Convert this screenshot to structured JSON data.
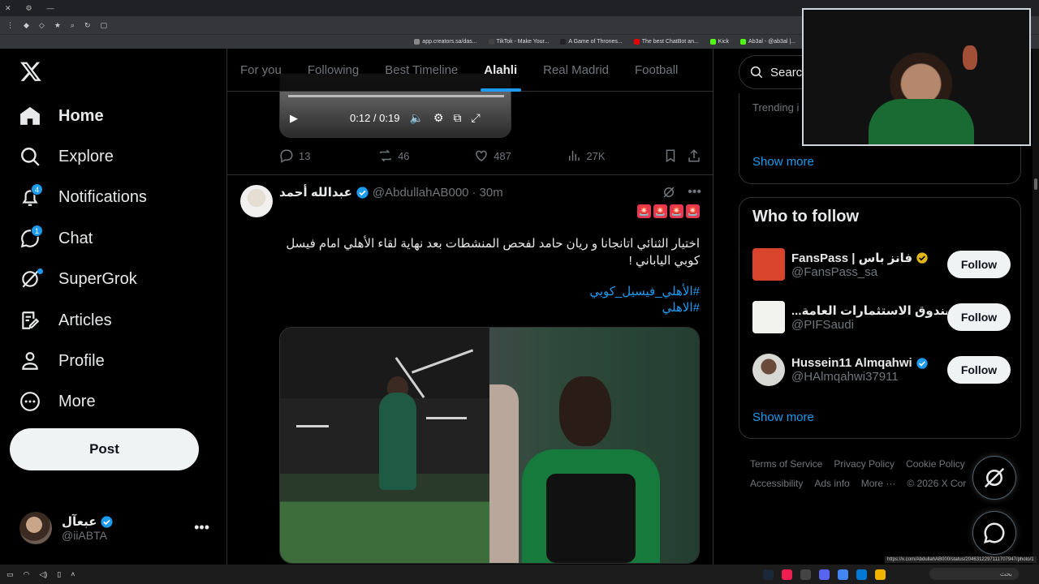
{
  "browser": {
    "bookmarks": [
      "app.creators.sa/das...",
      "TikTok - Make Your...",
      "A Game of Thrones...",
      "The best ChatBot an...",
      "Kick",
      "Ab3al - @ab3al |..."
    ]
  },
  "nav": {
    "items": [
      {
        "label": "Home",
        "icon": "home-icon"
      },
      {
        "label": "Explore",
        "icon": "search-icon"
      },
      {
        "label": "Notifications",
        "icon": "bell-icon",
        "badge": "4"
      },
      {
        "label": "Chat",
        "icon": "chat-icon",
        "badge": "1"
      },
      {
        "label": "SuperGrok",
        "icon": "grok-icon"
      },
      {
        "label": "Articles",
        "icon": "articles-icon"
      },
      {
        "label": "Profile",
        "icon": "profile-icon"
      },
      {
        "label": "More",
        "icon": "more-circle-icon"
      }
    ],
    "post_label": "Post",
    "account": {
      "name": "عبعآل",
      "handle": "@iiABTA",
      "more": "•••"
    }
  },
  "tabs": [
    "For you",
    "Following",
    "Best Timeline",
    "Alahli",
    "Real Madrid",
    "Football"
  ],
  "video": {
    "time": "0:12 / 0:19"
  },
  "prev_tweet_actions": {
    "replies": "13",
    "reposts": "46",
    "likes": "487",
    "views": "27K"
  },
  "tweet": {
    "name": "عبدالله أحمد",
    "handle": "@AbdullahAB000",
    "dot": "·",
    "time": "30m",
    "more": "•••",
    "emojis": [
      "🚨",
      "🚨",
      "🚨",
      "🚨"
    ],
    "text": "اختيار الثنائي اتانجانا و ريان حامد لفحص المنشطات بعد نهاية لقاء الأهلي امام فيسل كوبي الياباني !",
    "hashtags": [
      "#الأهلي_فيسيل_كوبي",
      "#الاهلي"
    ]
  },
  "right": {
    "search_placeholder": "Search",
    "trending_label": "Trending i",
    "show_more": "Show more",
    "wtf_title": "Who to follow",
    "who": [
      {
        "name": "FansPass | فانز باس",
        "handle": "@FansPass_sa",
        "verified": "gold",
        "follow": "Follow"
      },
      {
        "name": "...صندوق الاستثمارات العامة",
        "handle": "@PIFSaudi",
        "verified": "gray",
        "follow": "Follow"
      },
      {
        "name": "Hussein11 Almqahwi",
        "handle": "@HAlmqahwi37911",
        "verified": "blue",
        "follow": "Follow"
      }
    ],
    "show_more_2": "Show more",
    "footer": [
      "Terms of Service",
      "Privacy Policy",
      "Cookie Policy",
      "Accessibility",
      "Ads info",
      "More ···",
      "© 2026 X Cor"
    ]
  },
  "status_url": "https://x.com/AbdullahAB000/status/2046312297111707947/photo/1",
  "taskbar_search": "بحث",
  "colors": {
    "accent": "#1d9bf0",
    "bg": "#000000",
    "border": "#2f3336",
    "muted": "#71767b"
  }
}
